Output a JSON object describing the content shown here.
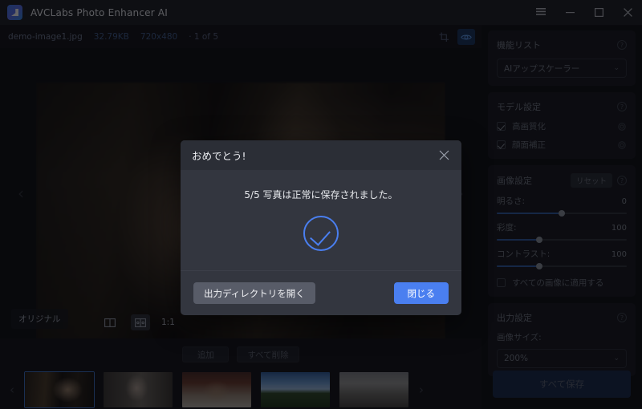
{
  "window": {
    "title": "AVCLabs Photo Enhancer AI",
    "logo_icon": "app-logo-icon",
    "controls": {
      "menu": "menu-icon",
      "minimize": "minimize-icon",
      "maximize": "maximize-icon",
      "close": "close-icon"
    }
  },
  "filebar": {
    "filename": "demo-image1.jpg",
    "filesize": "32.79KB",
    "dimensions": "720x480",
    "counter": "· 1 of 5",
    "crop_icon": "crop-icon",
    "eye_icon": "eye-icon"
  },
  "preview": {
    "original_badge": "オリジナル",
    "zoom_ratio": "1:1",
    "prev_icon": "chevron-left-icon",
    "next_icon": "chevron-right-icon",
    "split_view_icon": "split-view-icon",
    "compare_view_icon": "compare-view-icon"
  },
  "filelist": {
    "add_label": "追加",
    "delete_all_label": "すべて削除",
    "prev_icon": "chevron-left-icon",
    "next_icon": "chevron-right-icon",
    "thumbnails": [
      {
        "name": "thumbnail-1",
        "selected": true
      },
      {
        "name": "thumbnail-2",
        "selected": false
      },
      {
        "name": "thumbnail-3",
        "selected": false
      },
      {
        "name": "thumbnail-4",
        "selected": false
      },
      {
        "name": "thumbnail-5",
        "selected": false
      }
    ]
  },
  "sidebar": {
    "feature_list": {
      "title": "機能リスト",
      "info_icon": "info-icon",
      "selected_model": "AIアップスケーラー",
      "chevron": "⌄"
    },
    "model_settings": {
      "title": "モデル設定",
      "info_icon": "info-icon",
      "options": [
        {
          "label": "高画質化",
          "checked": true,
          "gear_icon": "gear-icon"
        },
        {
          "label": "顔面補正",
          "checked": true,
          "gear_icon": "gear-icon"
        }
      ]
    },
    "image_settings": {
      "title": "画像設定",
      "reset_label": "リセット",
      "info_icon": "info-icon",
      "sliders": [
        {
          "label": "明るさ:",
          "value": "0",
          "percent": 50
        },
        {
          "label": "彩度:",
          "value": "100",
          "percent": 33
        },
        {
          "label": "コントラスト:",
          "value": "100",
          "percent": 33
        }
      ],
      "apply_all_label": "すべての画像に適用する",
      "apply_all_checked": false
    },
    "output_settings": {
      "title": "出力設定",
      "info_icon": "info-icon",
      "image_size_label": "画像サイズ:",
      "image_size_value": "200%",
      "chevron": "⌄"
    },
    "save_all_label": "すべて保存"
  },
  "dialog": {
    "title": "おめでとう!",
    "close_icon": "close-icon",
    "message": "5/5 写真は正常に保存されました。",
    "success_icon": "check-circle-icon",
    "secondary_button": "出力ディレクトリを開く",
    "primary_button": "閉じる"
  },
  "colors": {
    "accent": "#4a7ff0",
    "window_bg": "#1b1d23",
    "panel_bg": "#15171d",
    "dialog_bg": "#33363f"
  }
}
